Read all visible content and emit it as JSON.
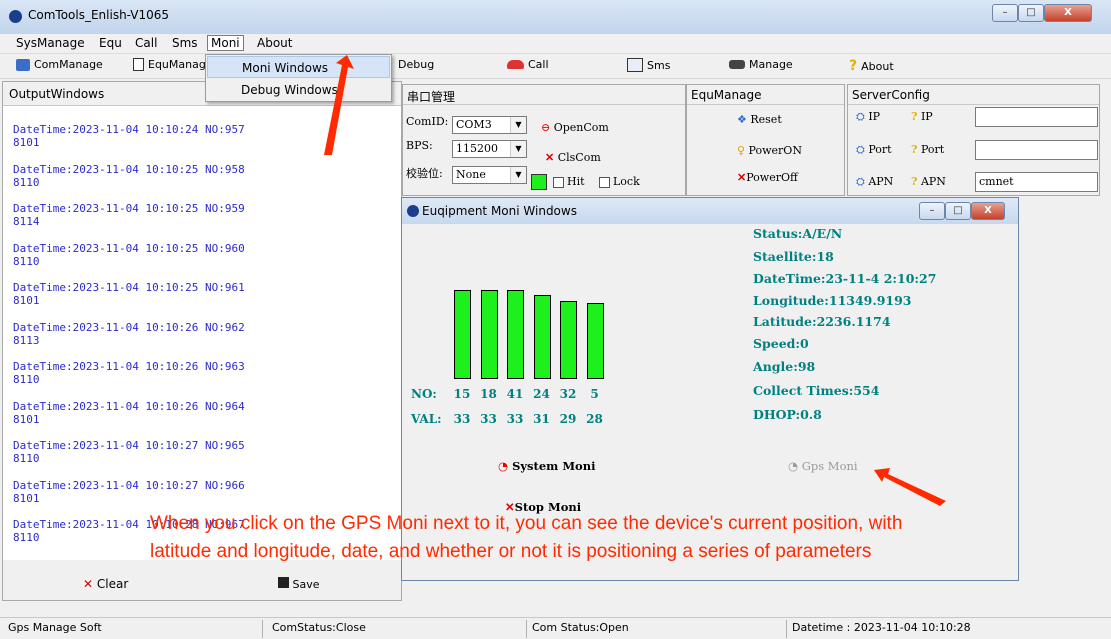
{
  "window": {
    "title": "ComTools_Enlish-V1065",
    "controls": [
      "–",
      "□",
      "X"
    ]
  },
  "menubar": {
    "items": [
      "SysManage",
      "Equ",
      "Call",
      "Sms",
      "Moni",
      "About"
    ]
  },
  "toolbar": {
    "comManage": "ComManage",
    "equManage": "EquManag",
    "debug": "Debug",
    "call": "Call",
    "sms": "Sms",
    "manage": "Manage",
    "about": "About"
  },
  "dropdown": {
    "moni": "Moni Windows",
    "debug": "Debug Windows"
  },
  "output": {
    "title": "OutputWindows",
    "entries": [
      {
        "dt": "DateTime:2023-11-04 10:10:24  NO:957",
        "val": "8101"
      },
      {
        "dt": "DateTime:2023-11-04 10:10:25  NO:958",
        "val": "8110"
      },
      {
        "dt": "DateTime:2023-11-04 10:10:25  NO:959",
        "val": "8114"
      },
      {
        "dt": "DateTime:2023-11-04 10:10:25  NO:960",
        "val": "8110"
      },
      {
        "dt": "DateTime:2023-11-04 10:10:25  NO:961",
        "val": "8101"
      },
      {
        "dt": "DateTime:2023-11-04 10:10:26  NO:962",
        "val": "8113"
      },
      {
        "dt": "DateTime:2023-11-04 10:10:26  NO:963",
        "val": "8110"
      },
      {
        "dt": "DateTime:2023-11-04 10:10:26  NO:964",
        "val": "8101"
      },
      {
        "dt": "DateTime:2023-11-04 10:10:27  NO:965",
        "val": "8110"
      },
      {
        "dt": "DateTime:2023-11-04 10:10:27  NO:966",
        "val": "8101"
      },
      {
        "dt": "DateTime:2023-11-04 10:10:28  NO:967",
        "val": "8110"
      }
    ],
    "clear": "Clear",
    "save": "Save"
  },
  "serial": {
    "title": "串口管理",
    "comid_label": "ComID:",
    "comid_value": "COM3",
    "bps_label": "BPS:",
    "bps_value": "115200",
    "parity_label": "校验位:",
    "parity_value": "None",
    "open": "OpenCom",
    "close": "ClsCom",
    "hit": "Hit",
    "lock": "Lock"
  },
  "equ": {
    "title": "EquManage",
    "reset": "Reset",
    "poweron": "PowerON",
    "poweroff": "PowerOff"
  },
  "server": {
    "title": "ServerConfig",
    "ip": "IP",
    "port": "Port",
    "apn": "APN",
    "apn_value": "cmnet"
  },
  "moni": {
    "title": "Euqipment Moni Windows",
    "no_label": "NO:",
    "val_label": "VAL:",
    "satellites": [
      {
        "no": "15",
        "val": "33"
      },
      {
        "no": "18",
        "val": "33"
      },
      {
        "no": "41",
        "val": "33"
      },
      {
        "no": "24",
        "val": "31"
      },
      {
        "no": "32",
        "val": "29"
      },
      {
        "no": "5",
        "val": "28"
      }
    ],
    "status": [
      "Status:A/E/N",
      "Staellite:18",
      "DateTime:23-11-4 2:10:27",
      "Longitude:11349.9193",
      "Latitude:2236.1174",
      "Speed:0",
      "Angle:98",
      "Collect Times:554",
      "DHOP:0.8"
    ],
    "system_moni": "System Moni",
    "gps_moni": "Gps Moni",
    "stop_moni": "Stop Moni"
  },
  "statusbar": {
    "app": "Gps Manage Soft",
    "com1": "ComStatus:Close",
    "com2": "Com Status:Open",
    "datetime": "Datetime : 2023-11-04 10:10:28"
  },
  "annotation": {
    "text": "When you click on the GPS Moni next to it, you can see the device's current position, with latitude and longitude, date, and whether or not it is positioning a series of parameters"
  },
  "colors": {
    "bar": "#1ef01e",
    "teal": "#008080",
    "log": "#2b2bcc",
    "annotation": "#ff2a00"
  }
}
